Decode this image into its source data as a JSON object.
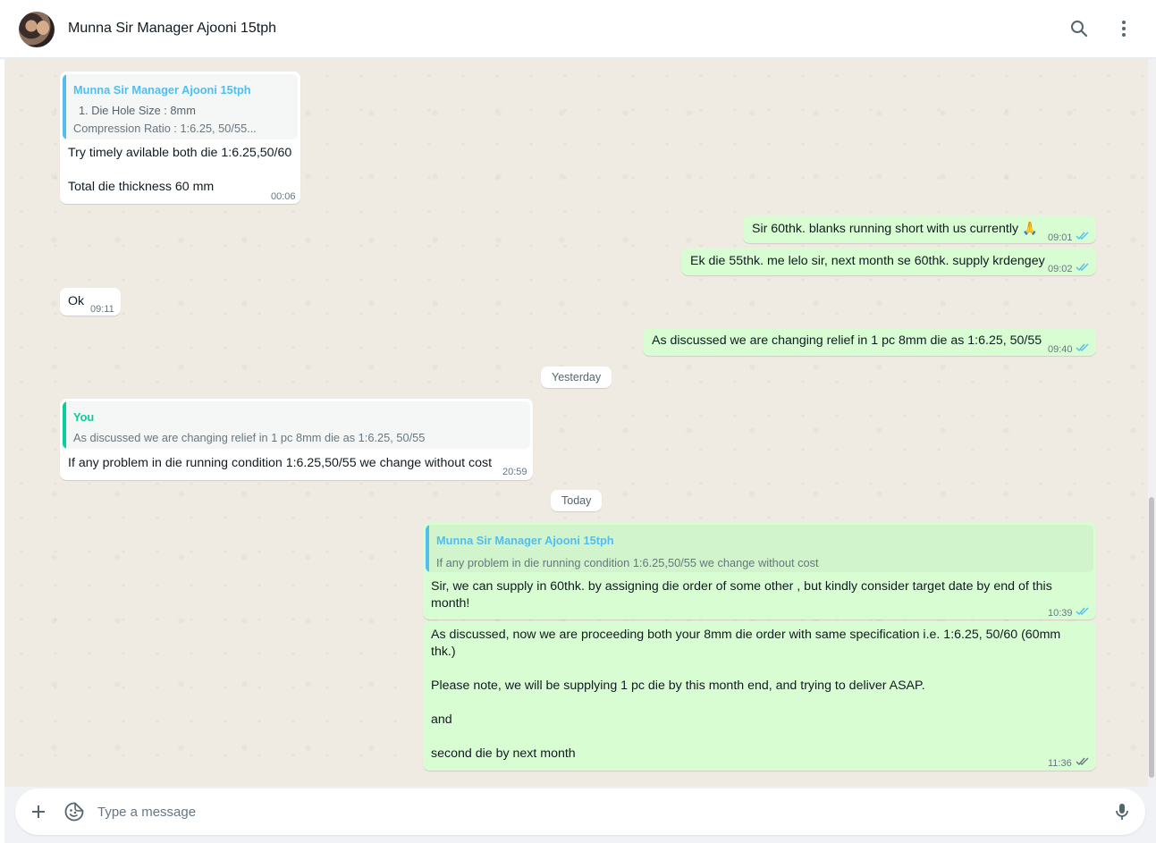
{
  "header": {
    "title": "Munna Sir Manager Ajooni 15tph",
    "icons": [
      "search-icon",
      "more-options-icon"
    ]
  },
  "separators": {
    "yesterday": "Yesterday",
    "today": "Today"
  },
  "messages": [
    {
      "direction": "in",
      "quote": {
        "name": "Munna Sir Manager Ajooni 15tph",
        "line1": "1.  Die Hole Size : 8mm",
        "line2": "Compression Ratio : 1:6.25, 50/55..."
      },
      "text": "Try timely avilable both die 1:6.25,50/60\n\nTotal die thickness 60 mm",
      "time": "00:06"
    },
    {
      "direction": "out",
      "text": "Sir 60thk. blanks running short with us currently 🙏",
      "time": "09:01",
      "status": "read"
    },
    {
      "direction": "out",
      "text": "Ek die 55thk. me lelo sir, next month se 60thk. supply krdengey",
      "time": "09:02",
      "status": "read"
    },
    {
      "direction": "in",
      "text": "Ok",
      "time": "09:11"
    },
    {
      "direction": "out",
      "text": "As discussed we are changing relief in 1 pc 8mm die as 1:6.25, 50/55",
      "time": "09:40",
      "status": "read"
    },
    {
      "direction": "in",
      "quote": {
        "name": "You",
        "line1": "As discussed we are changing relief in 1 pc 8mm die as 1:6.25, 50/55"
      },
      "text": "If any problem in die running condition 1:6.25,50/55 we change without cost",
      "time": "20:59"
    },
    {
      "direction": "out",
      "quote": {
        "name": "Munna Sir Manager Ajooni 15tph",
        "line1": "If any problem in die running condition 1:6.25,50/55 we change without cost"
      },
      "text": "Sir, we can supply in 60thk. by assigning die order of some other , but kindly consider target date by end of this\nmonth!",
      "time": "10:39",
      "status": "read"
    },
    {
      "direction": "out",
      "text": "As discussed, now we are proceeding both your 8mm die order with same specification i.e. 1:6.25, 50/60 (60mm\nthk.)\n\nPlease note, we will be supplying 1 pc die by this month end, and trying to deliver ASAP.\n\nand\n\nsecond die by next month",
      "time": "11:36",
      "status": "delivered"
    }
  ],
  "composer": {
    "placeholder": "Type a message",
    "icons": [
      "plus-icon",
      "sticker-icon",
      "microphone-icon"
    ]
  },
  "colors": {
    "chat_background": "#efeae2",
    "incoming_bubble": "#ffffff",
    "outgoing_bubble": "#d9fdd3",
    "read_ticks": "#53bdeb",
    "quote_name_contact": "#53bdeb",
    "quote_name_self": "#06cf9c"
  }
}
